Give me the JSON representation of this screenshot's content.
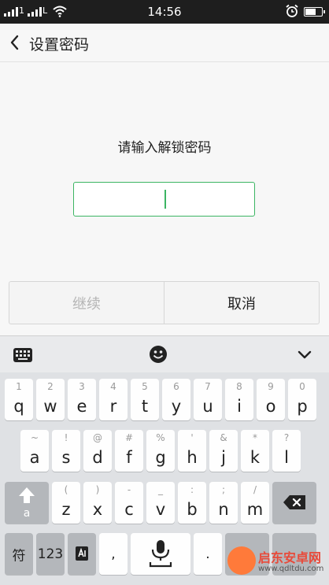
{
  "status_bar": {
    "sim1_label": "1",
    "sim2_label": "L",
    "time": "14:56"
  },
  "header": {
    "title": "设置密码",
    "back_icon": "chevron-left-icon"
  },
  "main": {
    "prompt": "请输入解锁密码",
    "password_value": "",
    "accent_color": "#3cb563"
  },
  "buttons": {
    "continue_label": "继续",
    "cancel_label": "取消"
  },
  "keyboard": {
    "toolbar": {
      "keyboard_icon": "keyboard-icon",
      "emoji_icon": "emoji-icon",
      "collapse_icon": "chevron-down-icon"
    },
    "row1": [
      {
        "hint": "1",
        "main": "q"
      },
      {
        "hint": "2",
        "main": "w"
      },
      {
        "hint": "3",
        "main": "e"
      },
      {
        "hint": "4",
        "main": "r"
      },
      {
        "hint": "5",
        "main": "t"
      },
      {
        "hint": "6",
        "main": "y"
      },
      {
        "hint": "7",
        "main": "u"
      },
      {
        "hint": "8",
        "main": "i"
      },
      {
        "hint": "9",
        "main": "o"
      },
      {
        "hint": "0",
        "main": "p"
      }
    ],
    "row2": [
      {
        "hint": "~",
        "main": "a"
      },
      {
        "hint": "!",
        "main": "s"
      },
      {
        "hint": "@",
        "main": "d"
      },
      {
        "hint": "#",
        "main": "f"
      },
      {
        "hint": "%",
        "main": "g"
      },
      {
        "hint": "'",
        "main": "h"
      },
      {
        "hint": "&",
        "main": "j"
      },
      {
        "hint": "*",
        "main": "k"
      },
      {
        "hint": "?",
        "main": "l"
      }
    ],
    "row3": [
      {
        "hint": "(",
        "main": "z"
      },
      {
        "hint": ")",
        "main": "x"
      },
      {
        "hint": "-",
        "main": "c"
      },
      {
        "hint": "_",
        "main": "v"
      },
      {
        "hint": ":",
        "main": "b"
      },
      {
        "hint": ";",
        "main": "n"
      },
      {
        "hint": "/",
        "main": "m"
      }
    ],
    "shift_label": "a",
    "symbols_label": "符",
    "numbers_label": "123",
    "comma_label": ",",
    "period_label": "."
  },
  "watermark": {
    "text": "启东安卓网",
    "url": "www.qdltdu.com"
  }
}
